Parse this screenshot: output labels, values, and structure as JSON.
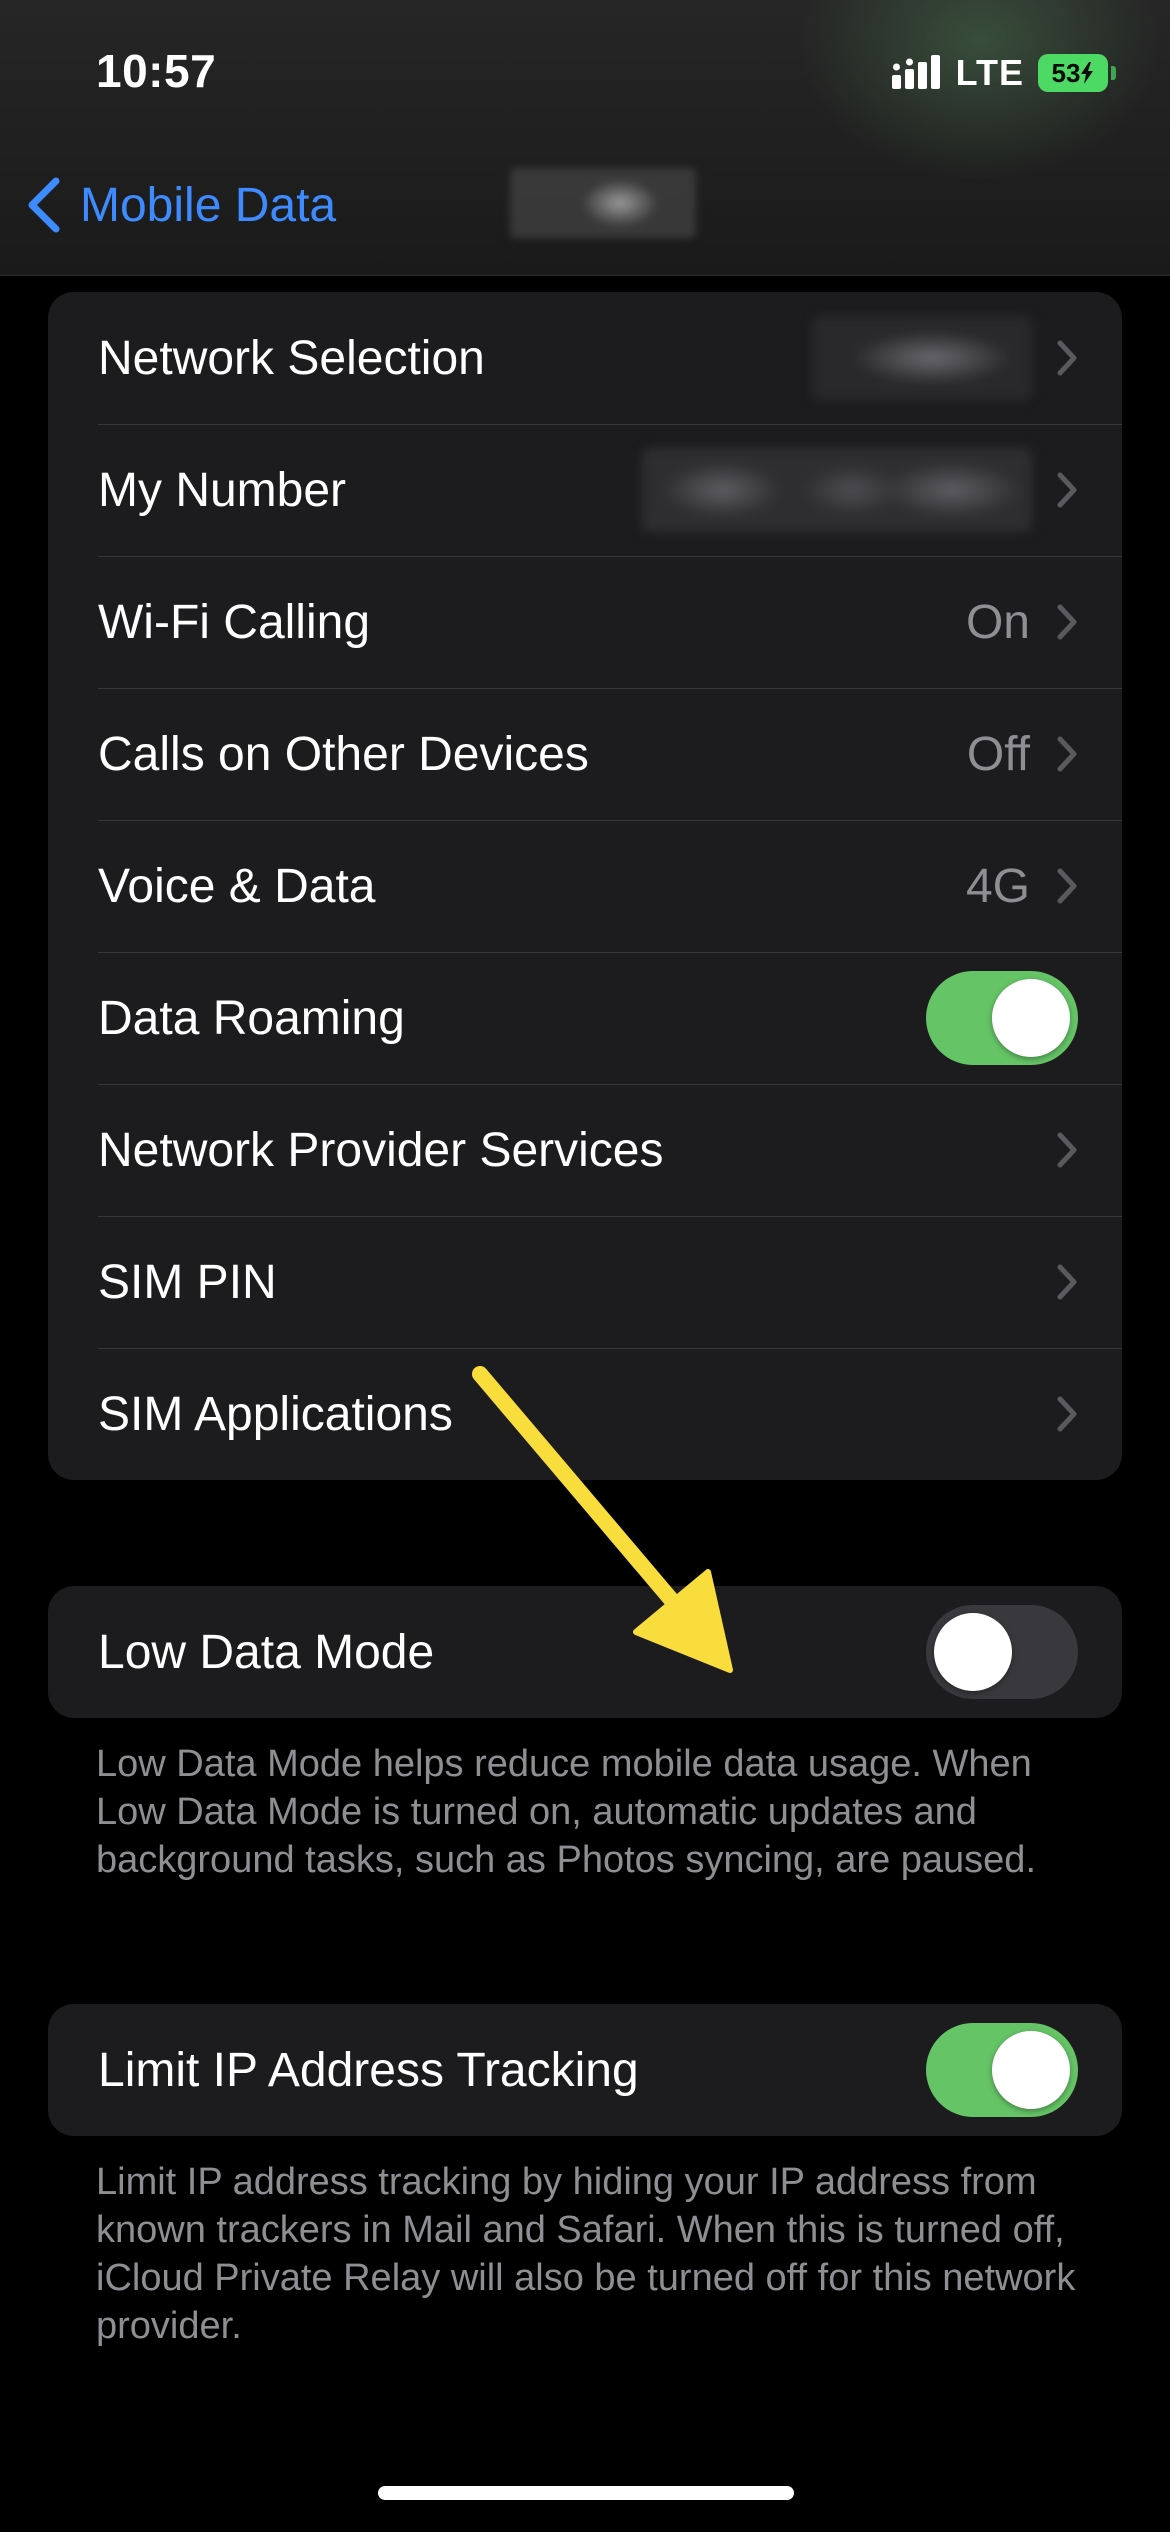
{
  "status_bar": {
    "time": "10:57",
    "network": "LTE",
    "battery": "53"
  },
  "nav": {
    "back_label": "Mobile Data"
  },
  "settings_group": [
    {
      "label": "Network Selection",
      "value": ""
    },
    {
      "label": "My Number",
      "value": ""
    },
    {
      "label": "Wi-Fi Calling",
      "value": "On"
    },
    {
      "label": "Calls on Other Devices",
      "value": "Off"
    },
    {
      "label": "Voice & Data",
      "value": "4G"
    },
    {
      "label": "Data Roaming",
      "toggle": true
    },
    {
      "label": "Network Provider Services",
      "value": ""
    },
    {
      "label": "SIM PIN",
      "value": ""
    },
    {
      "label": "SIM Applications",
      "value": ""
    }
  ],
  "low_data": {
    "label": "Low Data Mode",
    "toggle": false,
    "footnote": "Low Data Mode helps reduce mobile data usage. When Low Data Mode is turned on, automatic updates and background tasks, such as Photos syncing, are paused."
  },
  "limit_ip": {
    "label": "Limit IP Address Tracking",
    "toggle": true,
    "footnote": "Limit IP address tracking by hiding your IP address from known trackers in Mail and Safari. When this is turned off, iCloud Private Relay will also be turned off for this network provider."
  },
  "colors": {
    "accent_blue": "#3e8bff",
    "toggle_on": "#65c466",
    "toggle_off": "#39393d",
    "annotation_arrow": "#f9dd3c"
  },
  "icons": {
    "back": "chevron-left-icon",
    "row_disclosure": "chevron-right-icon",
    "signal": "signal-bars-icon",
    "battery": "battery-charging-icon",
    "annotation": "arrow-annotation-icon"
  }
}
